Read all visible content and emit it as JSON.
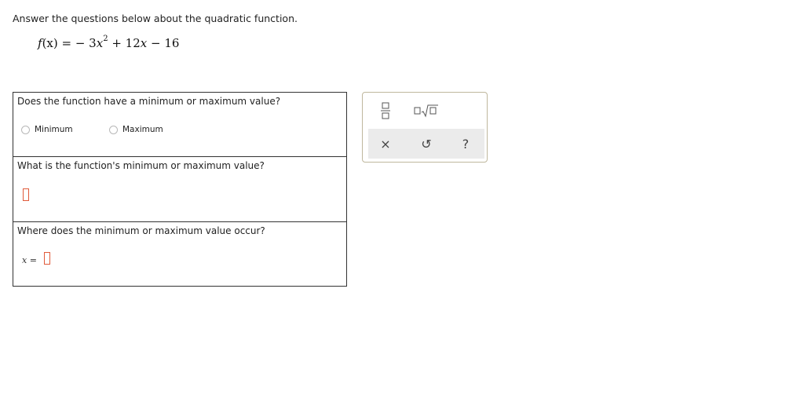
{
  "instructions": "Answer the questions below about the quadratic function.",
  "equation": {
    "lhs": "f",
    "arg": "(x)",
    "eq": " = − 3",
    "var": "x",
    "exp": "2",
    "rest1": " + 12",
    "var2": "x",
    "rest2": " − 16"
  },
  "questions": {
    "q1": {
      "text": "Does the function have a minimum or maximum value?",
      "options": [
        "Minimum",
        "Maximum"
      ]
    },
    "q2": {
      "text": "What is the function's minimum or maximum value?"
    },
    "q3": {
      "text": "Where does the minimum or maximum value occur?",
      "label_var": "x",
      "label_eq": " ="
    }
  },
  "palette": {
    "buttons": [
      "fraction-icon",
      "sqrt-icon"
    ],
    "tools": {
      "clear": "×",
      "undo": "↺",
      "help": "?"
    }
  },
  "colors": {
    "answer_box_border": "#e05a3a",
    "palette_border": "#bfb79d",
    "tool_row_bg": "#ebebeb"
  }
}
